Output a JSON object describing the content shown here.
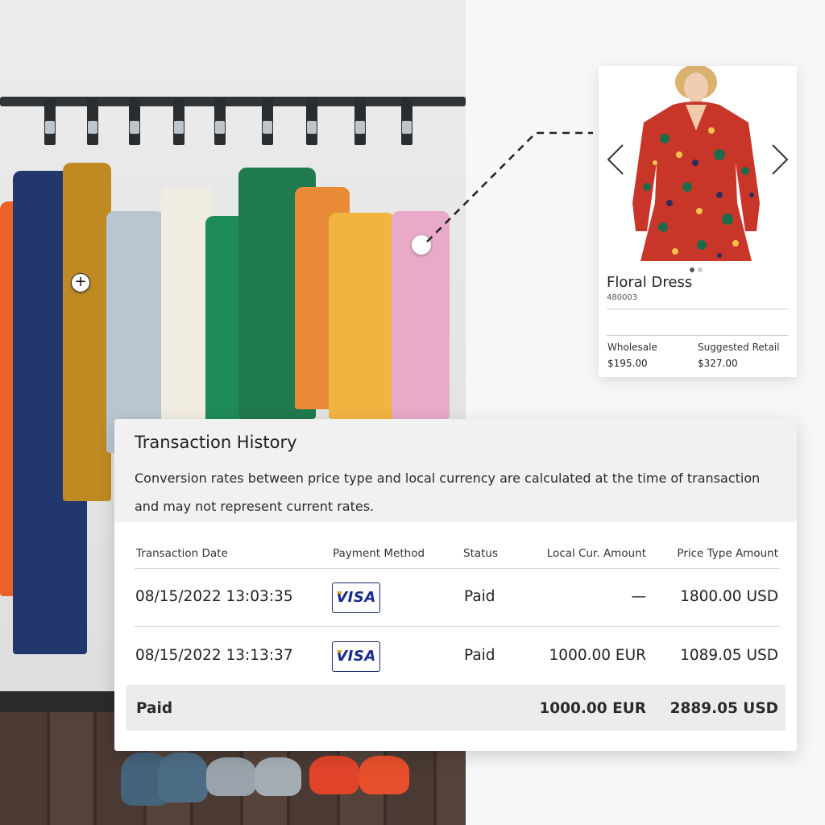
{
  "product_card": {
    "name": "Floral Dress",
    "sku": "480003",
    "wholesale_label": "Wholesale",
    "wholesale_value": "$195.00",
    "retail_label": "Suggested Retail",
    "retail_value": "$327.00",
    "carousel_total": 2,
    "carousel_active": 1
  },
  "transaction_history": {
    "title": "Transaction History",
    "note": "Conversion rates between price type and local currency are calculated at the time of transaction and may not represent current rates.",
    "columns": {
      "date": "Transaction Date",
      "method": "Payment Method",
      "status": "Status",
      "local": "Local Cur. Amount",
      "price_type": "Price Type Amount"
    },
    "rows": [
      {
        "date": "08/15/2022 13:03:35",
        "method": "VISA",
        "status": "Paid",
        "local": "—",
        "price_type": "1800.00 USD"
      },
      {
        "date": "08/15/2022 13:13:37",
        "method": "VISA",
        "status": "Paid",
        "local": "1000.00 EUR",
        "price_type": "1089.05 USD"
      }
    ],
    "total": {
      "label": "Paid",
      "local": "1000.00 EUR",
      "price_type": "2889.05 USD"
    }
  },
  "colors": {
    "visa_blue": "#1a2a8a",
    "panel_header": "#f1f1f2",
    "total_bar": "#ececec"
  }
}
